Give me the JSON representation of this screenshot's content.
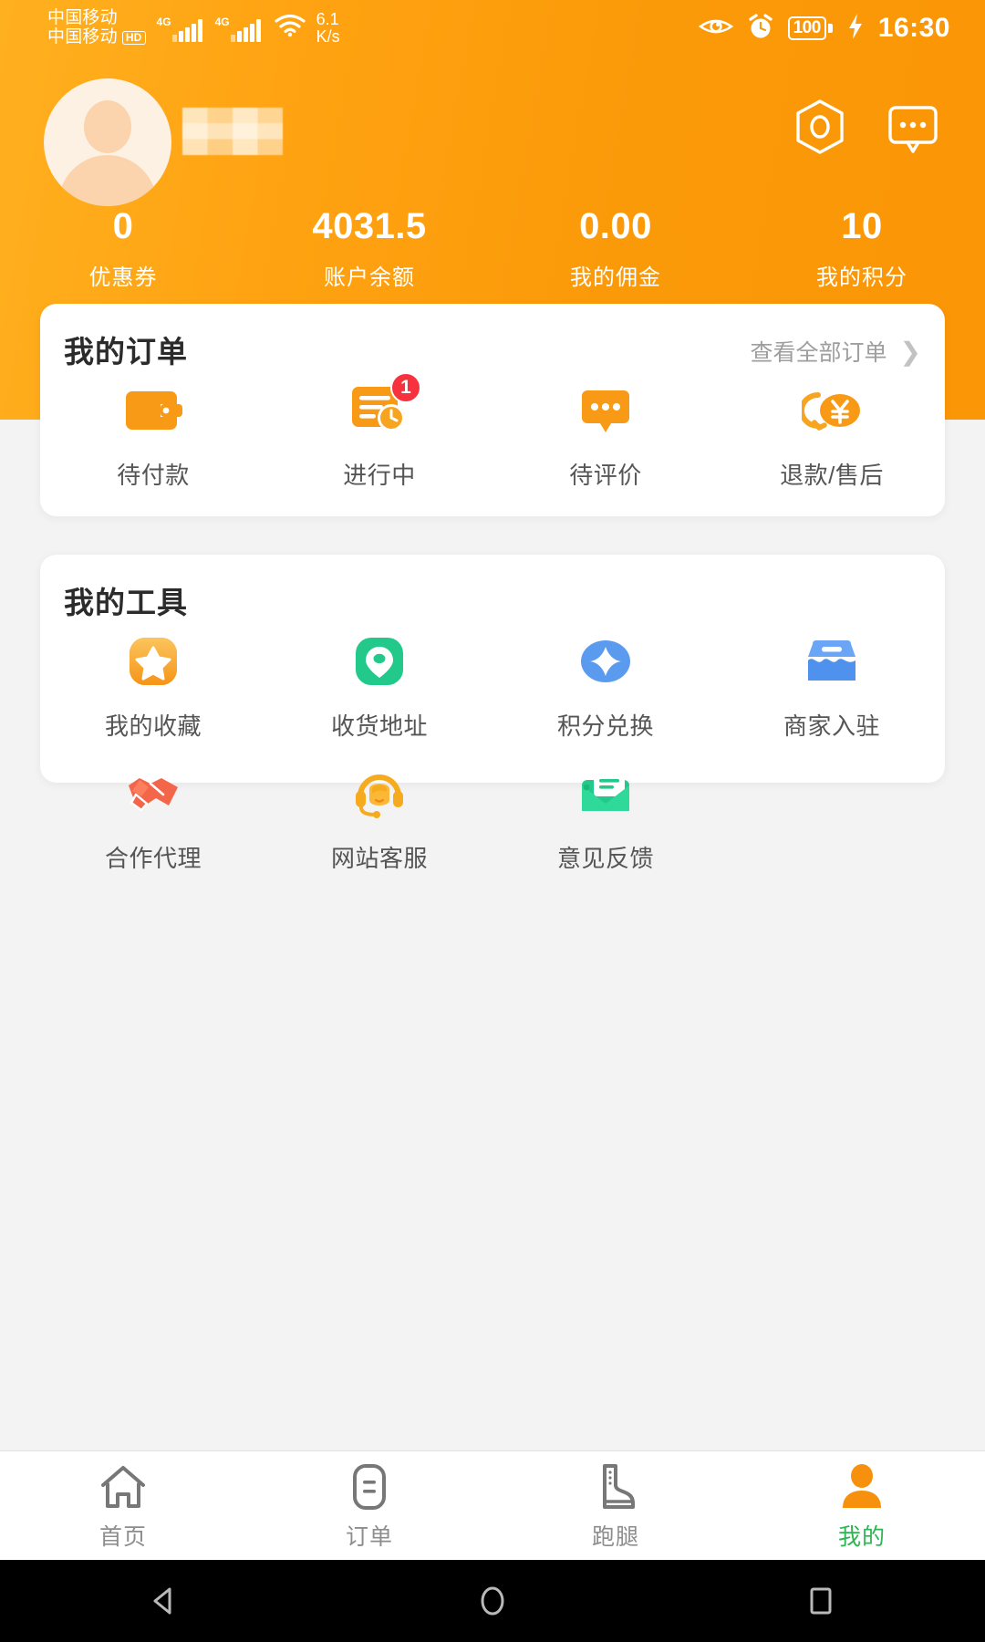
{
  "statusbar": {
    "carrier_line1": "中国移动",
    "carrier_line2": "中国移动",
    "hd_badge": "HD",
    "sim1_net": "4G",
    "sim2_net": "4G",
    "net_speed_value": "6.1",
    "net_speed_unit": "K/s",
    "battery_percent": "100",
    "time": "16:30",
    "icons": [
      "eye-icon",
      "alarm-icon",
      "battery-icon",
      "charging-bolt-icon"
    ]
  },
  "header": {
    "username": "",
    "avatar": "default-user-avatar",
    "scan_icon": "scan-hexagon-icon",
    "message_icon": "message-bubble-icon",
    "accent_color": "#fb9a09",
    "gradient_from": "#ffb01f",
    "gradient_to": "#fb9606",
    "stats": [
      {
        "value": "0",
        "label": "优惠券"
      },
      {
        "value": "4031.5",
        "label": "账户余额"
      },
      {
        "value": "0.00",
        "label": "我的佣金"
      },
      {
        "value": "10",
        "label": "我的积分"
      }
    ]
  },
  "orders": {
    "title": "我的订单",
    "more_label": "查看全部订单",
    "more_chevron": "chevron-right-icon",
    "items": [
      {
        "label": "待付款",
        "icon": "wallet-icon",
        "badge": ""
      },
      {
        "label": "进行中",
        "icon": "order-clock-icon",
        "badge": "1"
      },
      {
        "label": "待评价",
        "icon": "comment-dots-icon",
        "badge": ""
      },
      {
        "label": "退款/售后",
        "icon": "refund-yen-icon",
        "badge": ""
      }
    ]
  },
  "tools": {
    "title": "我的工具",
    "items": [
      {
        "label": "我的收藏",
        "icon": "star-favorite-icon",
        "color": "#f7a934"
      },
      {
        "label": "收货地址",
        "icon": "location-pin-icon",
        "color": "#22c98a"
      },
      {
        "label": "积分兑换",
        "icon": "diamond-points-icon",
        "color": "#5a9bf0"
      },
      {
        "label": "商家入驻",
        "icon": "shop-store-icon",
        "color": "#5a9bf0"
      },
      {
        "label": "合作代理",
        "icon": "handshake-icon",
        "color": "#f4664a"
      },
      {
        "label": "网站客服",
        "icon": "headset-support-icon",
        "color": "#f6ab1f"
      },
      {
        "label": "意见反馈",
        "icon": "feedback-envelope-icon",
        "color": "#22c98a"
      }
    ]
  },
  "tabbar": {
    "active_color": "#2db553",
    "items": [
      {
        "label": "首页",
        "icon": "home-icon",
        "active": false
      },
      {
        "label": "订单",
        "icon": "order-icon",
        "active": false
      },
      {
        "label": "跑腿",
        "icon": "boot-run-icon",
        "active": false
      },
      {
        "label": "我的",
        "icon": "user-icon",
        "active": true
      }
    ]
  },
  "androidnav": {
    "back": "back-triangle-icon",
    "home": "home-circle-icon",
    "recents": "recents-square-icon"
  }
}
